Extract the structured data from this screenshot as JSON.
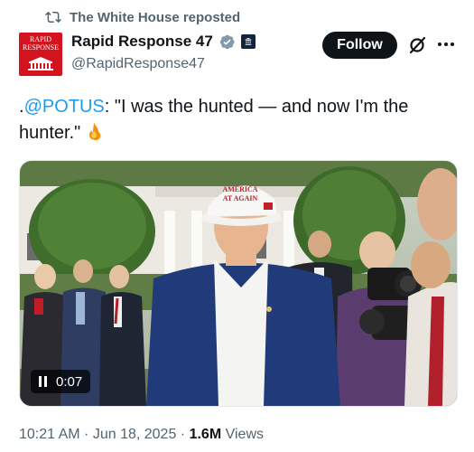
{
  "repost": {
    "label": "The White House reposted",
    "icon": "repost-icon"
  },
  "author": {
    "name": "Rapid Response 47",
    "handle": "@RapidResponse47",
    "avatar_line1": "RAPID",
    "avatar_line2": "RESPONSE",
    "verified_color": "#829aab"
  },
  "follow_label": "Follow",
  "tweet": {
    "prefix": ".",
    "mention": "@POTUS",
    "body": ": \"I was the hunted — and now I'm the hunter.\"",
    "emoji": "fire-emoji"
  },
  "media": {
    "timer": "0:07",
    "hat_text_line1": "AMERICA",
    "hat_text_line2": "AT AGAIN"
  },
  "meta": {
    "time": "10:21 AM",
    "sep1": " · ",
    "date": "Jun 18, 2025",
    "sep2": " · ",
    "views_count": "1.6M",
    "views_label": " Views"
  },
  "colors": {
    "accent": "#1d9bf0",
    "text": "#0f1419",
    "muted": "#536471",
    "avatar_red": "#d3141e"
  }
}
